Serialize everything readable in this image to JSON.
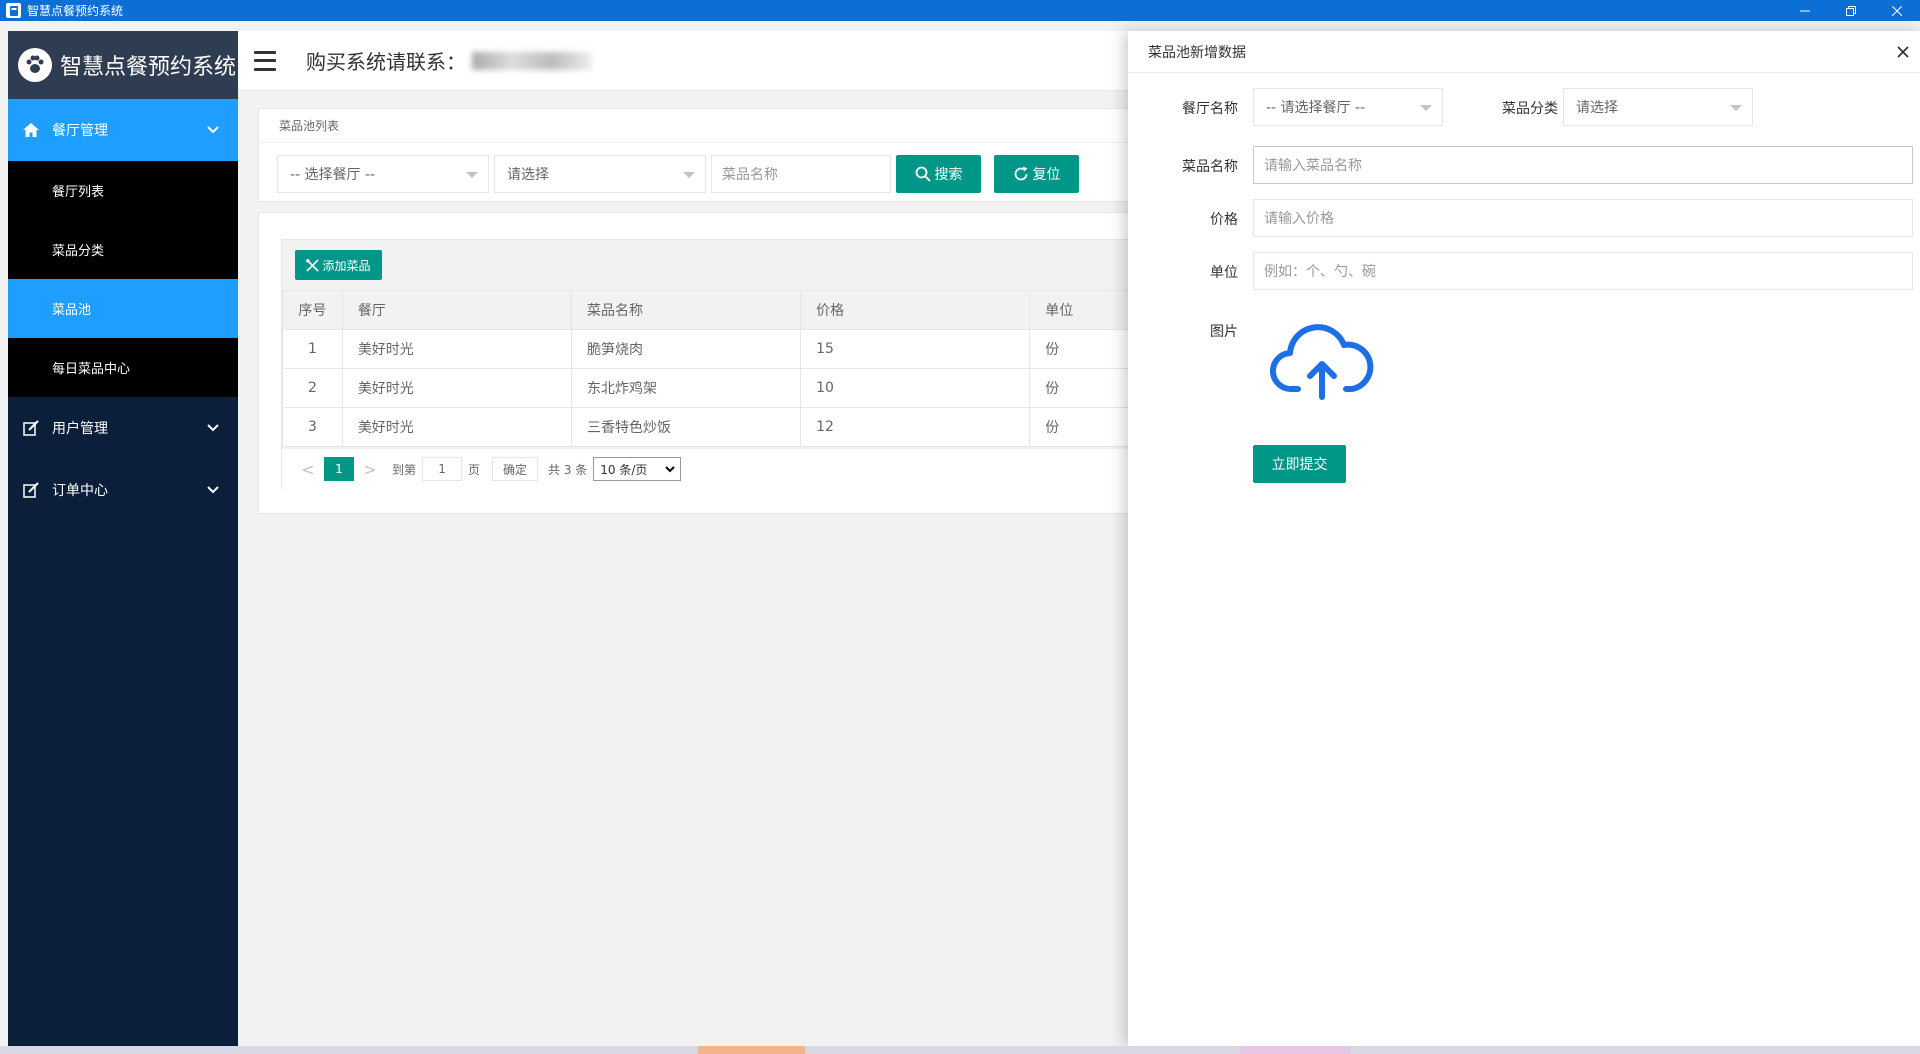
{
  "window": {
    "title": "智慧点餐预约系统"
  },
  "sidebar": {
    "logo_text": "智慧点餐预约系统",
    "menus": [
      {
        "label": "餐厅管理",
        "icon": "home-icon",
        "active": true
      },
      {
        "label": "用户管理",
        "icon": "edit-icon",
        "active": false
      },
      {
        "label": "订单中心",
        "icon": "edit-icon",
        "active": false
      }
    ],
    "submenus": [
      {
        "label": "餐厅列表",
        "active": false
      },
      {
        "label": "菜品分类",
        "active": false
      },
      {
        "label": "菜品池",
        "active": true
      },
      {
        "label": "每日菜品中心",
        "active": false
      }
    ]
  },
  "header": {
    "contact_label": "购买系统请联系："
  },
  "search": {
    "card_title": "菜品池列表",
    "restaurant_select": "-- 选择餐厅 --",
    "category_select": "请选择",
    "dish_name_placeholder": "菜品名称",
    "search_button": "搜索",
    "reset_button": "复位"
  },
  "table": {
    "add_button": "添加菜品",
    "headers": [
      "序号",
      "餐厅",
      "菜品名称",
      "价格",
      "单位"
    ],
    "rows": [
      [
        "1",
        "美好时光",
        "脆笋烧肉",
        "15",
        "份"
      ],
      [
        "2",
        "美好时光",
        "东北炸鸡架",
        "10",
        "份"
      ],
      [
        "3",
        "美好时光",
        "三香特色炒饭",
        "12",
        "份"
      ]
    ]
  },
  "pager": {
    "prev": "<",
    "current": "1",
    "next": ">",
    "goto_label": "到第",
    "goto_value": "1",
    "page_suffix": "页",
    "confirm": "确定",
    "total": "共 3 条",
    "page_size": "10 条/页"
  },
  "drawer": {
    "title": "菜品池新增数据",
    "restaurant_label": "餐厅名称",
    "restaurant_select": "-- 请选择餐厅 --",
    "category_label": "菜品分类",
    "category_select": "请选择",
    "name_label": "菜品名称",
    "name_placeholder": "请输入菜品名称",
    "price_label": "价格",
    "price_placeholder": "请输入价格",
    "unit_label": "单位",
    "unit_placeholder": "例如：个、勺、碗",
    "image_label": "图片",
    "submit_button": "立即提交"
  },
  "colors": {
    "sidebar_bg": "#0c1f3a",
    "active_blue": "#1e9fff",
    "teal": "#009688",
    "title_bar": "#0b6fd6",
    "upload_icon": "#1e6fe6"
  }
}
